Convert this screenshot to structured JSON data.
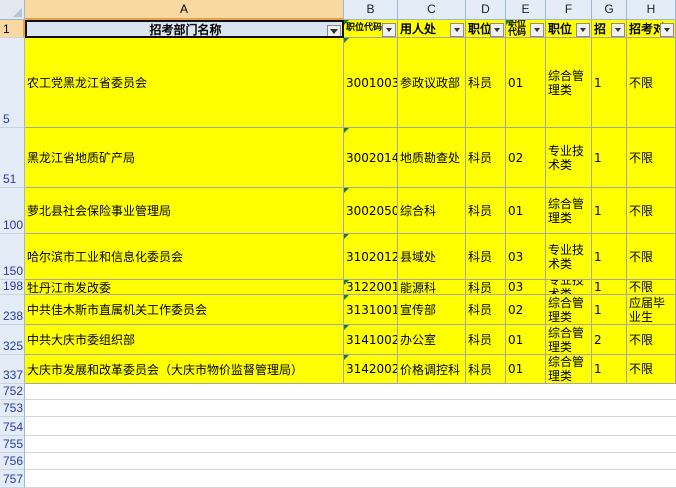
{
  "columns": [
    "A",
    "B",
    "C",
    "D",
    "E",
    "F",
    "G",
    "H"
  ],
  "headers": {
    "a": "招考部门名称",
    "b": "职位代码",
    "c": "用人处",
    "d": "职位",
    "e": "职位代码",
    "f": "职位",
    "g": "招",
    "h": "招考对"
  },
  "rows": [
    {
      "num": "5",
      "a": "农工党黑龙江省委员会",
      "b": "3001003",
      "c": "参政议政部",
      "d": "科员",
      "e": "01",
      "f": "综合管理类",
      "g": "1",
      "h": "不限"
    },
    {
      "num": "51",
      "a": "黑龙江省地质矿产局",
      "b": "3002014",
      "c": "地质勘查处",
      "d": "科员",
      "e": "02",
      "f": "专业技术类",
      "g": "1",
      "h": "不限"
    },
    {
      "num": "100",
      "a": "萝北县社会保险事业管理局",
      "b": "3002050",
      "c": "综合科",
      "d": "科员",
      "e": "01",
      "f": "综合管理类",
      "g": "1",
      "h": "不限"
    },
    {
      "num": "150",
      "a": "哈尔滨市工业和信息化委员会",
      "b": "3102012",
      "c": "县域处",
      "d": "科员",
      "e": "03",
      "f": "专业技术类",
      "g": "1",
      "h": "不限"
    },
    {
      "num": "198",
      "a": "牡丹江市发改委",
      "b": "3122001",
      "c": "能源科",
      "d": "科员",
      "e": "03",
      "f": "专业技术类",
      "g": "1",
      "h": "不限"
    },
    {
      "num": "238",
      "a": "中共佳木斯市直属机关工作委员会",
      "b": "3131001",
      "c": "宣传部",
      "d": "科员",
      "e": "02",
      "f": "综合管理类",
      "g": "1",
      "h": "应届毕业生"
    },
    {
      "num": "325",
      "a": "中共大庆市委组织部",
      "b": "3141002",
      "c": "办公室",
      "d": "科员",
      "e": "01",
      "f": "综合管理类",
      "g": "2",
      "h": "不限"
    },
    {
      "num": "337",
      "a": "大庆市发展和改革委员会（大庆市物价监督管理局）",
      "b": "3142002",
      "c": "价格调控科",
      "d": "科员",
      "e": "01",
      "f": "综合管理类",
      "g": "1",
      "h": "不限"
    }
  ],
  "empty_rows": [
    "752",
    "753",
    "754",
    "755",
    "756",
    "757"
  ],
  "colors": {
    "fill": "#ffff00",
    "header_fill": "#dbe5f1",
    "selected_header": "#f9d99f"
  }
}
